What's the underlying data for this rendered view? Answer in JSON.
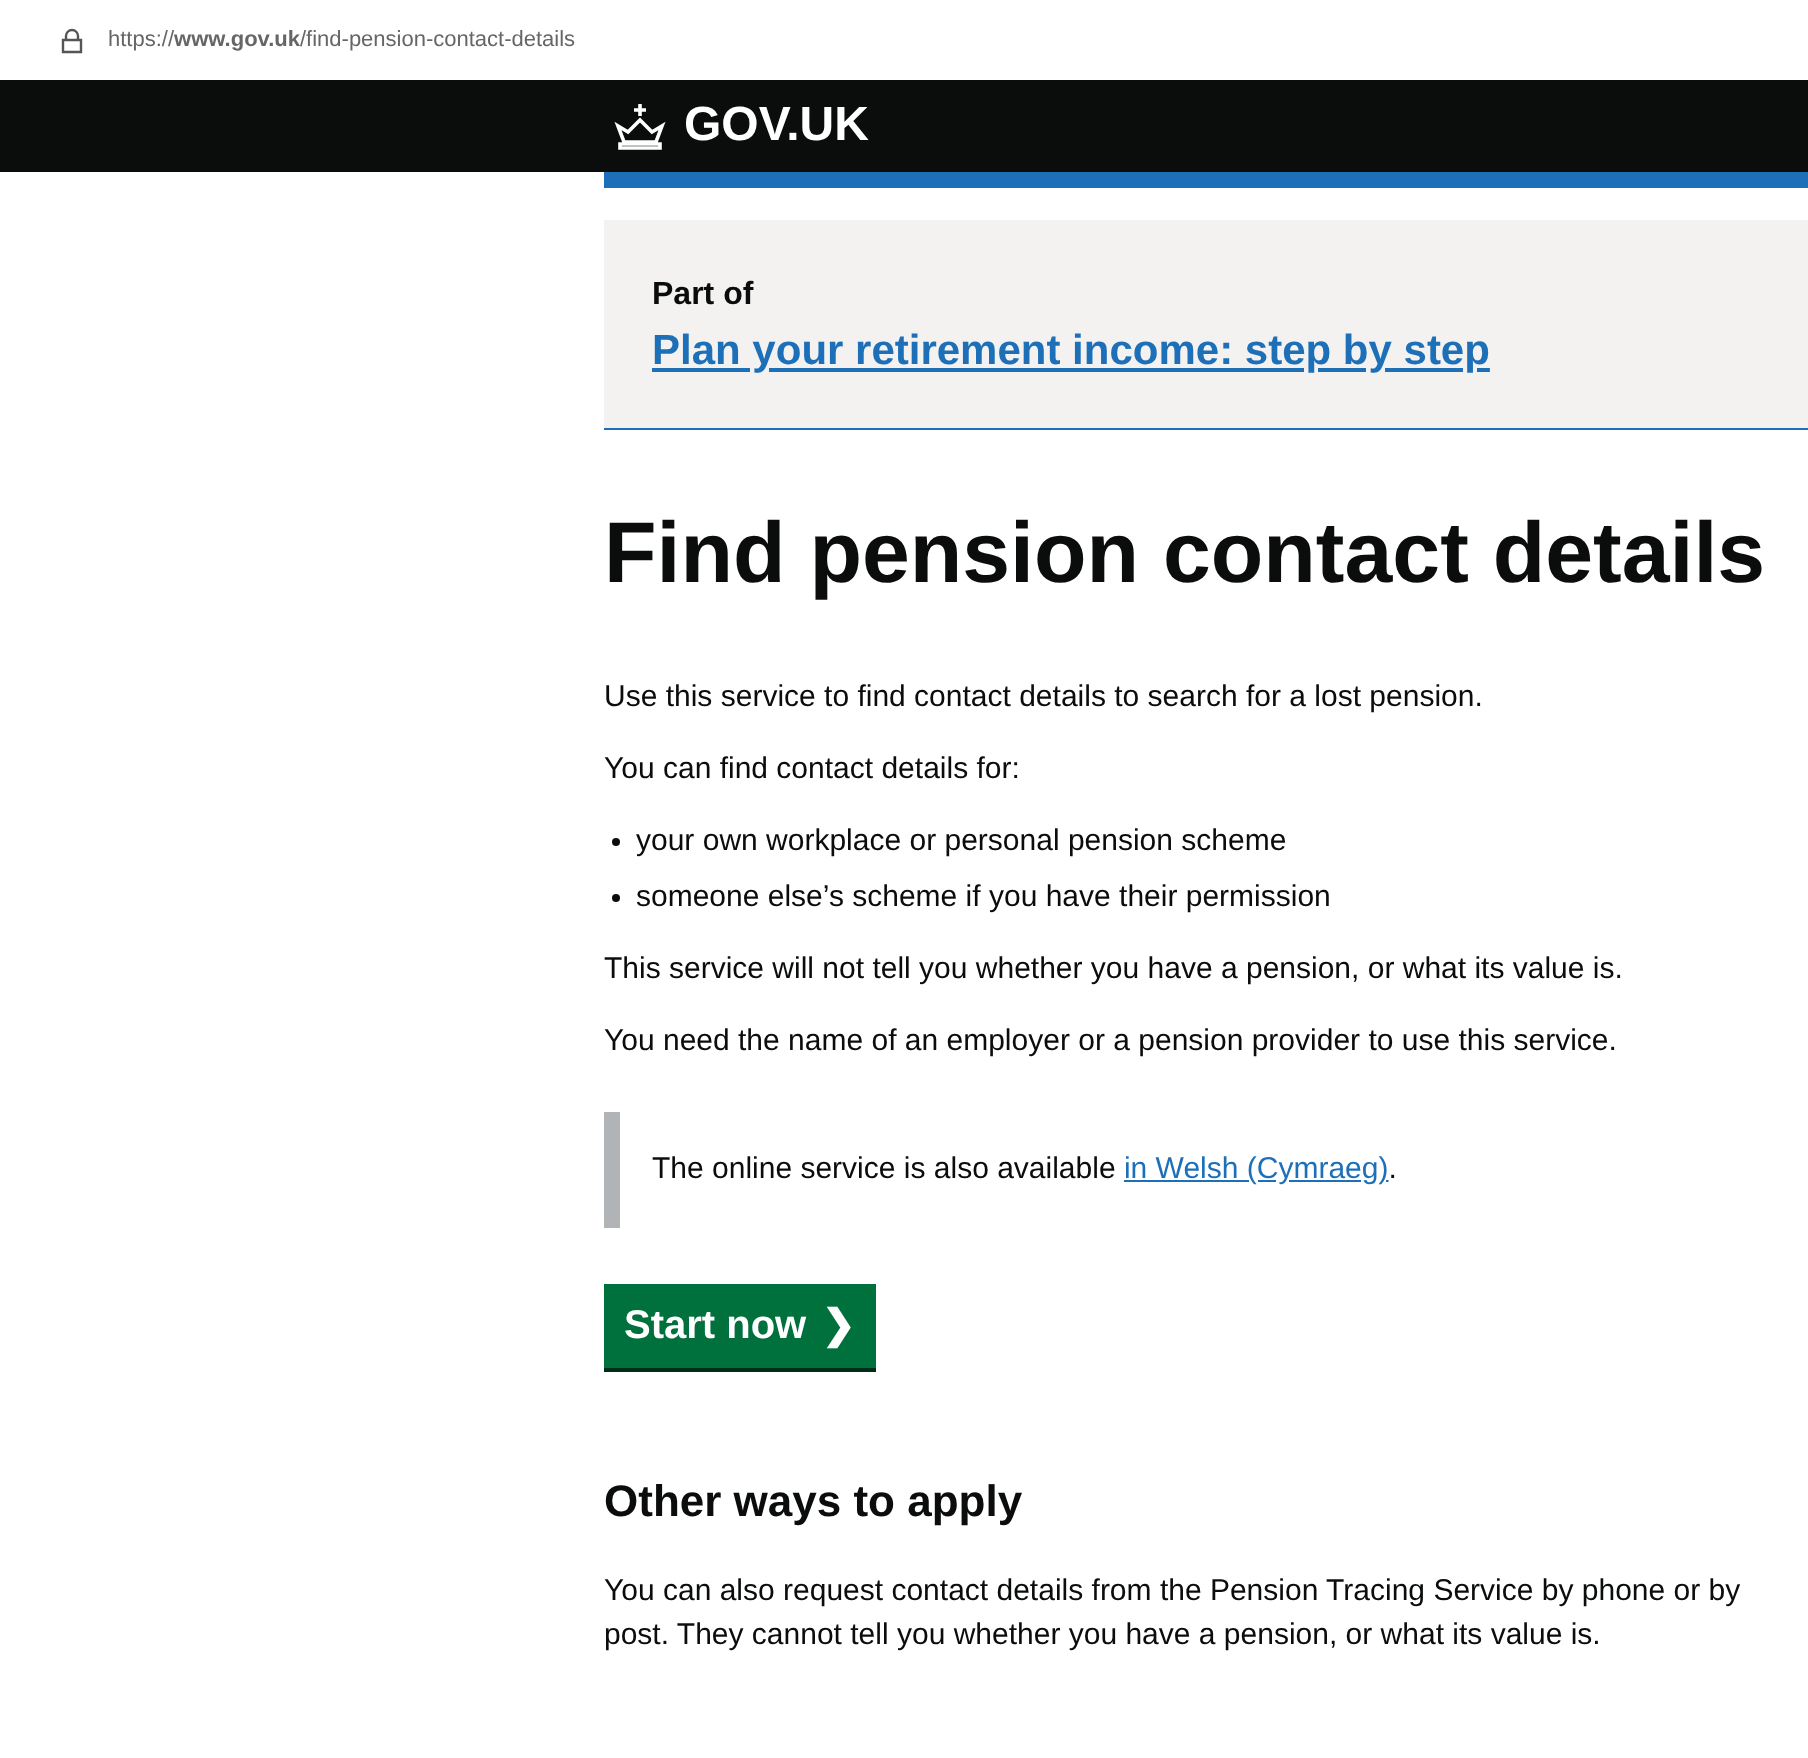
{
  "browser": {
    "url": "https://**www.gov.uk**/find-pension-contact-details"
  },
  "header": {
    "logo": "GOV.UK"
  },
  "step_by_step": {
    "label": "Part of",
    "link": "Plan your retirement income: step by step"
  },
  "title": "Find pension contact details",
  "intro": [
    "Use this service to find contact details to search for a lost pension.",
    "You can find contact details for:"
  ],
  "bullets": [
    "your own workplace or personal pension scheme",
    "someone else’s scheme if you have their permission"
  ],
  "paragraphs": [
    "This service will not tell you whether you have a pension, or what its value is.",
    "You need the name of an employer or a pension provider to use this service."
  ],
  "inset": {
    "text": "The online service is also available ",
    "link": "in Welsh (Cymraeg)",
    "after": "."
  },
  "start_button": {
    "label": "Start now",
    "arrow": "❯"
  },
  "other_ways": {
    "heading": "Other ways to apply",
    "text": "You can also request contact details from the Pension Tracing Service by phone or by post. They cannot tell you whether you have a pension, or what its value is."
  }
}
